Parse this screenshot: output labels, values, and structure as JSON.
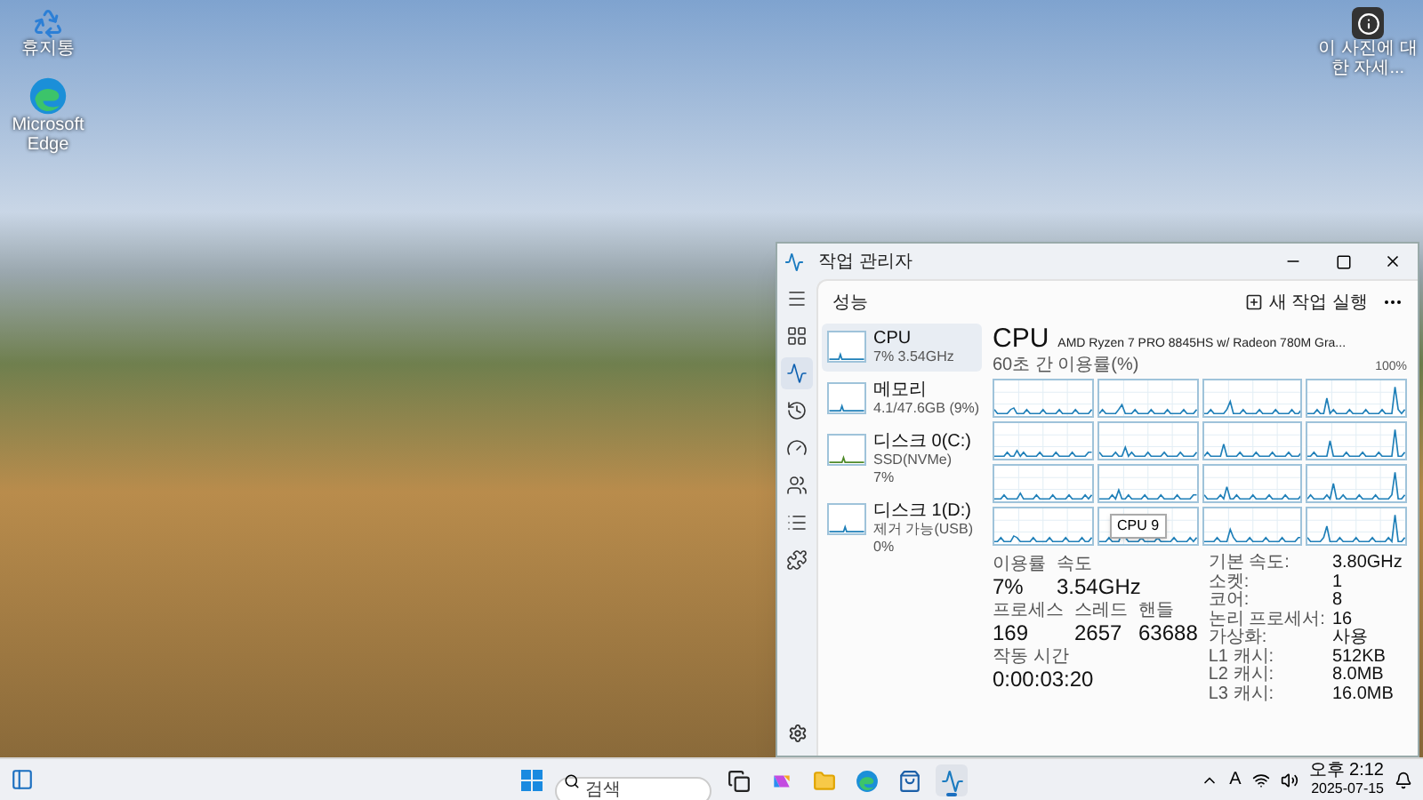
{
  "desktop_icons": [
    {
      "kind": "recycle",
      "label": "휴지통"
    },
    {
      "kind": "edge",
      "label": "Microsoft Edge"
    }
  ],
  "spotlight": {
    "label": "이 사진에 대한 자세..."
  },
  "window": {
    "title": "작업 관리자"
  },
  "nav_items": [
    {
      "kind": "menu",
      "selected": false
    },
    {
      "kind": "processes",
      "selected": false
    },
    {
      "kind": "performance",
      "selected": true
    },
    {
      "kind": "history",
      "selected": false
    },
    {
      "kind": "startup",
      "selected": false
    },
    {
      "kind": "users",
      "selected": false
    },
    {
      "kind": "details",
      "selected": false
    },
    {
      "kind": "services",
      "selected": false
    }
  ],
  "page": {
    "title": "성능",
    "run_task": "새 작업 실행"
  },
  "resources": [
    {
      "name": "CPU",
      "lines": [
        "7% 3.54GHz"
      ],
      "selected": true
    },
    {
      "name": "메모리",
      "lines": [
        "4.1/47.6GB (9%)"
      ],
      "selected": false
    },
    {
      "name": "디스크 0(C:)",
      "lines": [
        "SSD(NVMe)",
        "7%"
      ],
      "selected": false
    },
    {
      "name": "디스크 1(D:)",
      "lines": [
        "제거 가능(USB)",
        "0%"
      ],
      "selected": false
    }
  ],
  "detail": {
    "title": "CPU",
    "model": "AMD Ryzen 7 PRO 8845HS w/ Radeon 780M Gra...",
    "graph_label": "60초 간 이용률(%)",
    "graph_max": "100%",
    "tooltip": "CPU 9",
    "stats": [
      [
        {
          "label": "이용률",
          "value": "7%"
        },
        {
          "label": "속도",
          "value": "3.54GHz"
        }
      ],
      [
        {
          "label": "프로세스",
          "value": "169"
        },
        {
          "label": "스레드",
          "value": "2657"
        },
        {
          "label": "핸들",
          "value": "63688"
        }
      ],
      [
        {
          "label": "작동 시간",
          "value": "0:00:03:20"
        }
      ]
    ],
    "specs": [
      {
        "label": "기본 속도:",
        "value": "3.80GHz"
      },
      {
        "label": "소켓:",
        "value": "1"
      },
      {
        "label": "코어:",
        "value": "8"
      },
      {
        "label": "논리 프로세서:",
        "value": "16"
      },
      {
        "label": "가상화:",
        "value": "사용"
      },
      {
        "label": "L1 캐시:",
        "value": "512KB"
      },
      {
        "label": "L2 캐시:",
        "value": "8.0MB"
      },
      {
        "label": "L3 캐시:",
        "value": "16.0MB"
      }
    ]
  },
  "taskbar": {
    "search": {
      "placeholder": "검색"
    },
    "pinned": [
      {
        "kind": "taskview",
        "running": false
      },
      {
        "kind": "copilot",
        "running": false
      },
      {
        "kind": "explorer",
        "running": false
      },
      {
        "kind": "edge",
        "running": false
      },
      {
        "kind": "store",
        "running": false
      },
      {
        "kind": "taskmanager",
        "running": true
      }
    ],
    "ime": "A",
    "time": "오후 2:12",
    "date": "2025-07-15"
  }
}
